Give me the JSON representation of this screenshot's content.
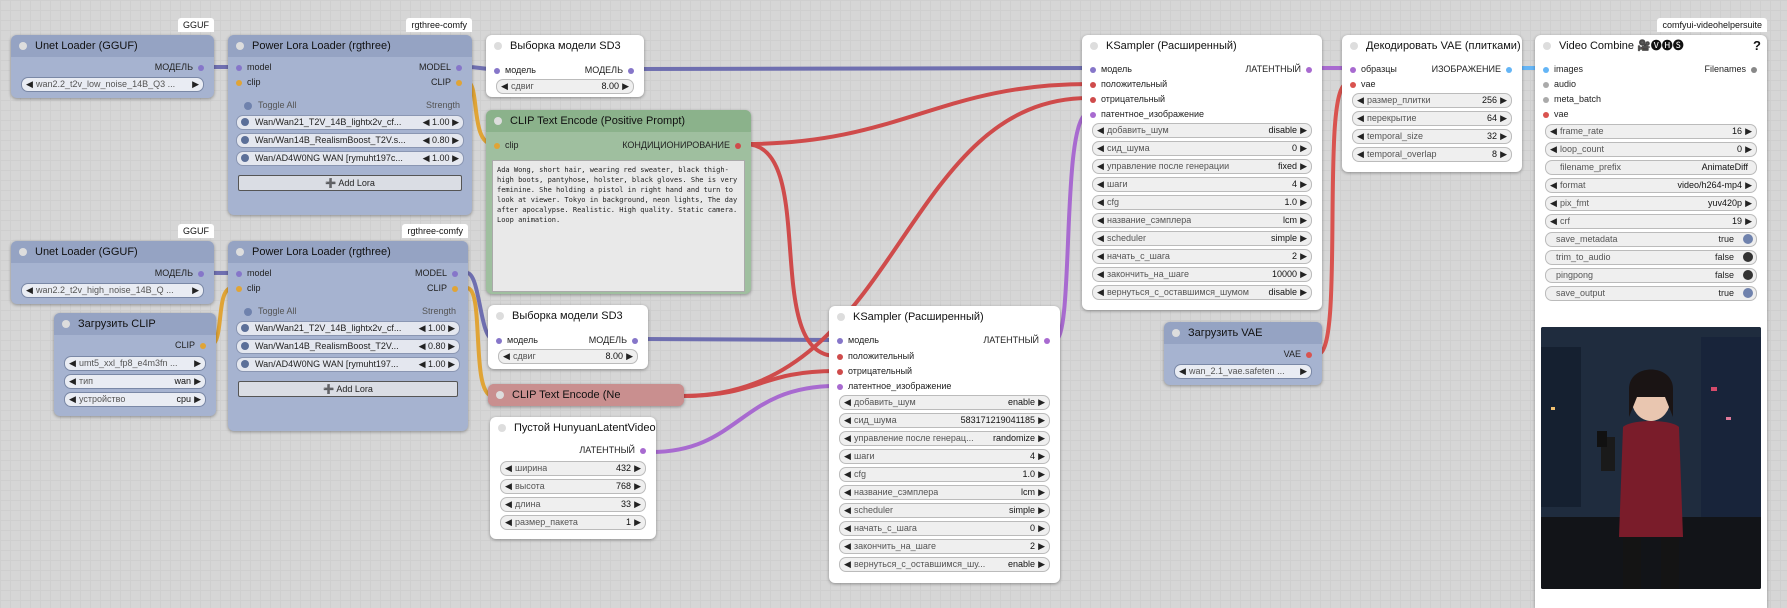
{
  "colors": {
    "model": "#8676c9",
    "clip": "#e0a436",
    "cond": "#cf4b4b",
    "latent": "#a86ad0",
    "image": "#64b5f6",
    "vae": "#d9534f",
    "wire_model": "#6f6fb0"
  },
  "unet1": {
    "badge": "GGUF",
    "title": "Unet Loader (GGUF)",
    "out": "МОДЕЛЬ",
    "value": "wan2.2_t2v_low_noise_14B_Q3 ..."
  },
  "unet2": {
    "badge": "GGUF",
    "title": "Unet Loader (GGUF)",
    "out": "МОДЕЛЬ",
    "value": "wan2.2_t2v_high_noise_14B_Q ..."
  },
  "lora1": {
    "badge": "rgthree-comfy",
    "title": "Power Lora Loader (rgthree)",
    "in_model": "model",
    "in_clip": "clip",
    "out_model": "MODEL",
    "out_clip": "CLIP",
    "toggle_all": "Toggle All",
    "strength": "Strength",
    "add": "➕ Add Lora",
    "loras": [
      {
        "name": "Wan/Wan21_T2V_14B_lightx2v_cf...",
        "str": "1.00"
      },
      {
        "name": "Wan/Wan14B_RealismBoost_T2V.s...",
        "str": "0.80"
      },
      {
        "name": "Wan/AD4W0NG WAN [rymuht197c...",
        "str": "1.00"
      }
    ]
  },
  "lora2": {
    "badge": "rgthree-comfy",
    "title": "Power Lora Loader (rgthree)",
    "in_model": "model",
    "in_clip": "clip",
    "out_model": "MODEL",
    "out_clip": "CLIP",
    "toggle_all": "Toggle All",
    "strength": "Strength",
    "add": "➕ Add Lora",
    "loras": [
      {
        "name": "Wan/Wan21_T2V_14B_lightx2v_cf...",
        "str": "1.00"
      },
      {
        "name": "Wan/Wan14B_RealismBoost_T2V...",
        "str": "0.80"
      },
      {
        "name": "Wan/AD4W0NG WAN [rymuht197...",
        "str": "1.00"
      }
    ]
  },
  "clipload": {
    "title": "Загрузить CLIP",
    "out": "CLIP",
    "w": [
      {
        "lab": "",
        "val": "umt5_xxl_fp8_e4m3fn ..."
      },
      {
        "lab": "тип",
        "val": "wan"
      },
      {
        "lab": "устройство",
        "val": "cpu"
      }
    ]
  },
  "sd3a": {
    "title": "Выборка модели SD3",
    "in": "модель",
    "out": "МОДЕЛЬ",
    "w_lab": "сдвиг",
    "w_val": "8.00"
  },
  "sd3b": {
    "title": "Выборка модели SD3",
    "in": "модель",
    "out": "МОДЕЛЬ",
    "w_lab": "сдвиг",
    "w_val": "8.00"
  },
  "clippos": {
    "title": "CLIP Text Encode (Positive Prompt)",
    "in": "clip",
    "out": "КОНДИЦИОНИРОВАНИЕ",
    "text": "Ada Wong, short hair, wearing red sweater, black thigh-high boots, pantyhose, holster, black gloves. She is very feminine. She holding a pistol in right hand and turn to look at viewer. Tokyo in background, neon lights, The day after apocalypse. Realistic. High quality. Static camera. Loop animation."
  },
  "clipneg": {
    "title": "CLIP Text Encode (Ne"
  },
  "latent": {
    "title": "Пустой HunyuanLatentVideo",
    "out": "ЛАТЕНТНЫЙ",
    "w": [
      {
        "lab": "ширина",
        "val": "432"
      },
      {
        "lab": "высота",
        "val": "768"
      },
      {
        "lab": "длина",
        "val": "33"
      },
      {
        "lab": "размер_пакета",
        "val": "1"
      }
    ]
  },
  "ks1": {
    "title": "KSampler (Расширенный)",
    "out": "ЛАТЕНТНЫЙ",
    "ins": [
      "модель",
      "положительный",
      "отрицательный",
      "патентное_изображение"
    ],
    "w": [
      {
        "lab": "добавить_шум",
        "val": "disable"
      },
      {
        "lab": "сид_шума",
        "val": "0"
      },
      {
        "lab": "управление после генерации",
        "val": "fixed"
      },
      {
        "lab": "шаги",
        "val": "4"
      },
      {
        "lab": "cfg",
        "val": "1.0"
      },
      {
        "lab": "название_сэмплера",
        "val": "lcm"
      },
      {
        "lab": "scheduler",
        "val": "simple"
      },
      {
        "lab": "начать_с_шага",
        "val": "2"
      },
      {
        "lab": "закончить_на_шаге",
        "val": "10000"
      },
      {
        "lab": "вернуться_с_оставшимся_шумом",
        "val": "disable"
      }
    ]
  },
  "ks2": {
    "title": "KSampler (Расширенный)",
    "out": "ЛАТЕНТНЫЙ",
    "ins": [
      "модель",
      "положительный",
      "отрицательный",
      "латентное_изображение"
    ],
    "w": [
      {
        "lab": "добавить_шум",
        "val": "enable"
      },
      {
        "lab": "сид_шума",
        "val": "583171219041185"
      },
      {
        "lab": "управление после генерац...",
        "val": "randomize"
      },
      {
        "lab": "шаги",
        "val": "4"
      },
      {
        "lab": "cfg",
        "val": "1.0"
      },
      {
        "lab": "название_сэмплера",
        "val": "lcm"
      },
      {
        "lab": "scheduler",
        "val": "simple"
      },
      {
        "lab": "начать_с_шага",
        "val": "0"
      },
      {
        "lab": "закончить_на_шаге",
        "val": "2"
      },
      {
        "lab": "вернуться_с_оставшимся_шу...",
        "val": "enable"
      }
    ]
  },
  "vaedec": {
    "title": "Декодировать VAE (плитками)",
    "in1": "образцы",
    "in2": "vae",
    "out": "ИЗОБРАЖЕНИЕ",
    "w": [
      {
        "lab": "размер_плитки",
        "val": "256"
      },
      {
        "lab": "перекрытие",
        "val": "64"
      },
      {
        "lab": "temporal_size",
        "val": "32"
      },
      {
        "lab": "temporal_overlap",
        "val": "8"
      }
    ]
  },
  "vaeload": {
    "title": "Загрузить VAE",
    "out": "VAE",
    "value": "wan_2.1_vae.safeten ..."
  },
  "vc": {
    "badge": "comfyui-videohelpersuite",
    "title": "Video Combine 🎥🅥🅗🅢",
    "help": "?",
    "out": "Filenames",
    "ins": [
      "images",
      "audio",
      "meta_batch",
      "vae"
    ],
    "w": [
      {
        "lab": "frame_rate",
        "val": "16"
      },
      {
        "lab": "loop_count",
        "val": "0"
      },
      {
        "lab": "filename_prefix",
        "val": "AnimateDiff"
      },
      {
        "lab": "format",
        "val": "video/h264-mp4"
      },
      {
        "lab": "pix_fmt",
        "val": "yuv420p"
      },
      {
        "lab": "crf",
        "val": "19"
      }
    ],
    "t": [
      {
        "lab": "save_metadata",
        "val": "true"
      },
      {
        "lab": "trim_to_audio",
        "val": "false"
      },
      {
        "lab": "pingpong",
        "val": "false"
      },
      {
        "lab": "save_output",
        "val": "true"
      }
    ]
  }
}
